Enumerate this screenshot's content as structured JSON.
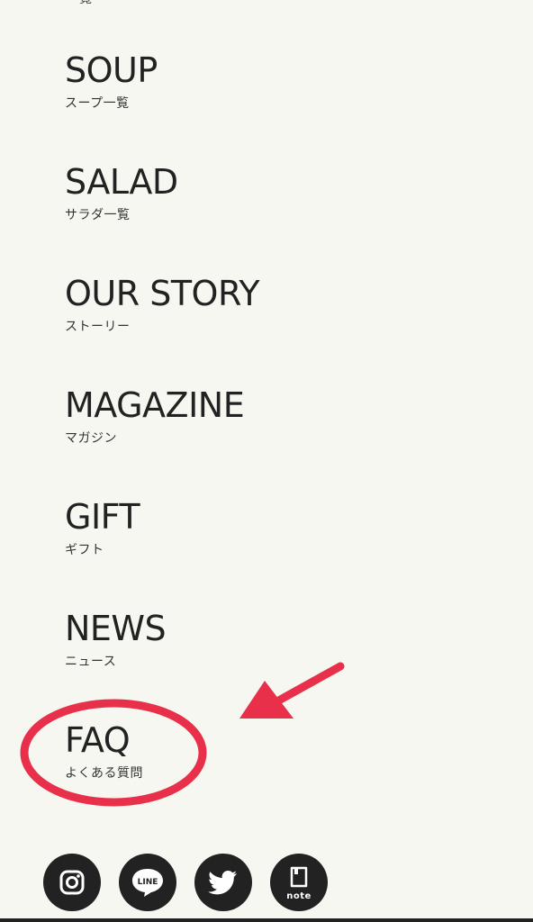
{
  "partial_top_label": "一覧",
  "menu": [
    {
      "key": "soup",
      "title": "SOUP",
      "sub": "スープ一覧"
    },
    {
      "key": "salad",
      "title": "SALAD",
      "sub": "サラダ一覧"
    },
    {
      "key": "our-story",
      "title": "OUR STORY",
      "sub": "ストーリー"
    },
    {
      "key": "magazine",
      "title": "MAGAZINE",
      "sub": "マガジン"
    },
    {
      "key": "gift",
      "title": "GIFT",
      "sub": "ギフト"
    },
    {
      "key": "news",
      "title": "NEWS",
      "sub": "ニュース"
    },
    {
      "key": "faq",
      "title": "FAQ",
      "sub": "よくある質問"
    }
  ],
  "social": {
    "instagram_icon": "instagram-icon",
    "line_icon": "line-icon",
    "line_text": "LINE",
    "twitter_icon": "twitter-icon",
    "note_icon": "note-icon",
    "note_text": "note"
  },
  "colors": {
    "background": "#f7f7f2",
    "text": "#222222",
    "annotation": "#e8304a",
    "social_bg": "#222222"
  }
}
